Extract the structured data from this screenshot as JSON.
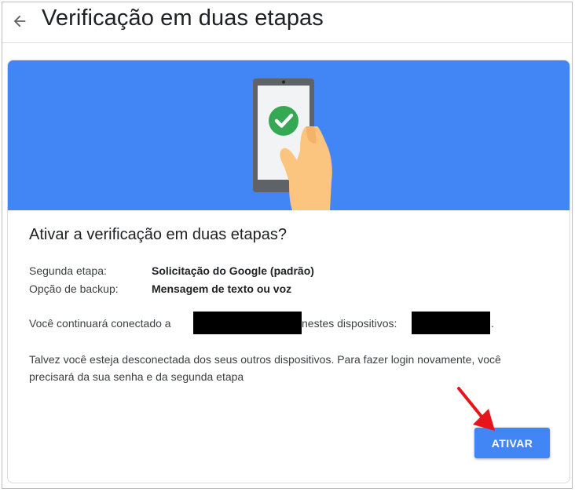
{
  "header": {
    "back_icon": "arrow-back-icon",
    "title": "Verificação em duas etapas"
  },
  "banner": {
    "illustration": "phone-check-icon",
    "accent_color": "#4285f4",
    "check_color": "#34a853"
  },
  "content": {
    "heading": "Ativar a verificação em duas etapas?",
    "rows": [
      {
        "label": "Segunda etapa:",
        "value": "Solicitação do Google (padrão)"
      },
      {
        "label": "Opção de backup:",
        "value": "Mensagem de texto ou voz"
      }
    ],
    "connected_prefix": "Você continuará conectado a",
    "connected_middle": "nestes dispositivos:",
    "connected_suffix": ".",
    "paragraph": "Talvez você esteja desconectada dos seus outros dispositivos. Para fazer login novamente, você precisará da sua senha e da segunda etapa"
  },
  "actions": {
    "activate_label": "ATIVAR",
    "pointer_icon": "red-arrow-annotation-icon"
  }
}
